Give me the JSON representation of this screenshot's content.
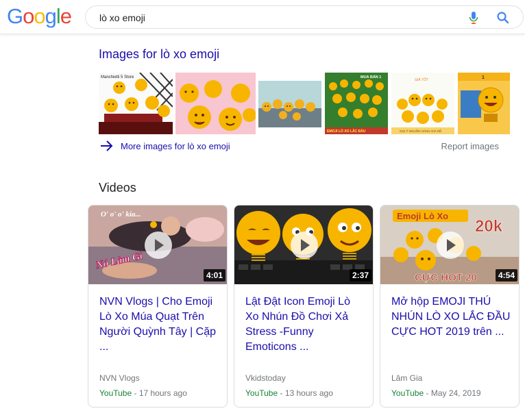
{
  "logo": {
    "letters": [
      "G",
      "o",
      "o",
      "g",
      "l",
      "e"
    ],
    "colors": [
      "#4285F4",
      "#EA4335",
      "#FBBC05",
      "#4285F4",
      "#34A853",
      "#EA4335"
    ]
  },
  "search": {
    "query": "lò xo emoji"
  },
  "images": {
    "title": "Images for lò xo emoji",
    "thumb_text": [
      "Manchietti 5 Store",
      "MUA BÁN 1",
      "EMOJI LÒ XO LẮC ĐẦU",
      "GIÁ TỐT",
      "GỌI Ý NGUỒN HÀNG GIÁ RẺ",
      "1"
    ],
    "more_label": "More images for lò xo emoji",
    "report_label": "Report images"
  },
  "videos": {
    "title": "Videos",
    "items": [
      {
        "title": "NVN Vlogs | Cho Emoji Lò Xo Múa Quạt Trên Người Quỳnh Tây | Cặp ...",
        "duration": "4:01",
        "channel": "NVN Vlogs",
        "source": "YouTube",
        "time": " - 17 hours ago",
        "overlay": "Nó Làm Gì"
      },
      {
        "title": "Lật Đật Icon Emoji Lò Xo Nhún Đồ Chơi Xả Stress -Funny Emoticons ...",
        "duration": "2:37",
        "channel": "Vkidstoday",
        "source": "YouTube",
        "time": " - 13 hours ago",
        "overlay": ""
      },
      {
        "title": "Mở hộp EMOJI THÚ NHÚN LÒ XO LẮC ĐẦU CỰC HOT 2019 trên ...",
        "duration": "4:54",
        "channel": "Lâm Gia",
        "source": "YouTube",
        "time": " - May 24, 2019",
        "overlay_top": "Emoji Lò Xo",
        "overlay_price": "20k",
        "overlay_bottom": "CỰC HOT 20"
      }
    ]
  },
  "colors": {
    "link": "#1a0dab",
    "green": "#188038",
    "emoji_yellow": "#F7B500"
  }
}
